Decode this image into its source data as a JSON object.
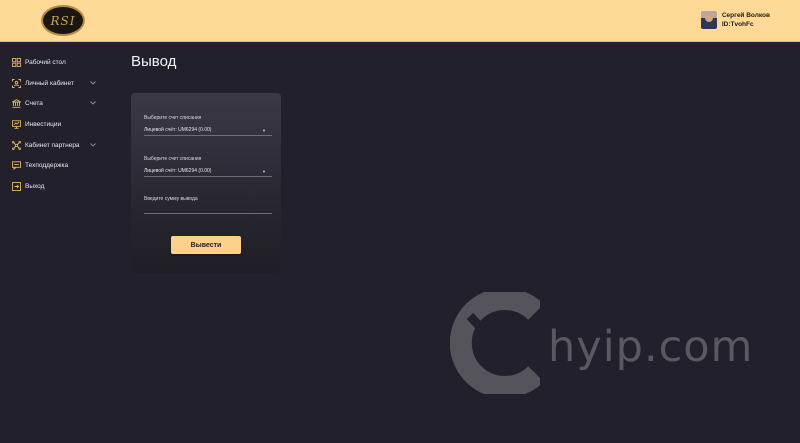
{
  "header": {
    "logo_text": "RSI",
    "user_name": "Сергей Волков",
    "user_id": "ID:TvohFc"
  },
  "sidebar": {
    "items": [
      {
        "label": "Рабочий стол",
        "icon": "dashboard-grid-icon"
      },
      {
        "label": "Личный кабинет",
        "icon": "user-focus-icon",
        "expandable": true
      },
      {
        "label": "Счета",
        "icon": "bank-icon",
        "expandable": true
      },
      {
        "label": "Инвестиции",
        "icon": "monitor-chart-icon"
      },
      {
        "label": "Кабинет партнера",
        "icon": "network-icon",
        "expandable": true
      },
      {
        "label": "Техподдержка",
        "icon": "support-chat-icon"
      },
      {
        "label": "Выход",
        "icon": "logout-icon"
      }
    ]
  },
  "main": {
    "title": "Вывод",
    "form": {
      "field1_label": "Выберите счет списания",
      "field1_value": "Лицевой счёт: UM6294 (0.00)",
      "field2_label": "Выберите счет списания",
      "field2_value": "Лицевой счёт: UM6294 (0.00)",
      "amount_label": "Введите сумму вывода",
      "amount_value": "",
      "submit_label": "Вывести"
    }
  },
  "watermark": {
    "text": "hyip.com"
  },
  "colors": {
    "header_bg": "#ffd996",
    "page_bg": "#22212b",
    "accent": "#ffd08a",
    "icon": "#e3b45e"
  }
}
